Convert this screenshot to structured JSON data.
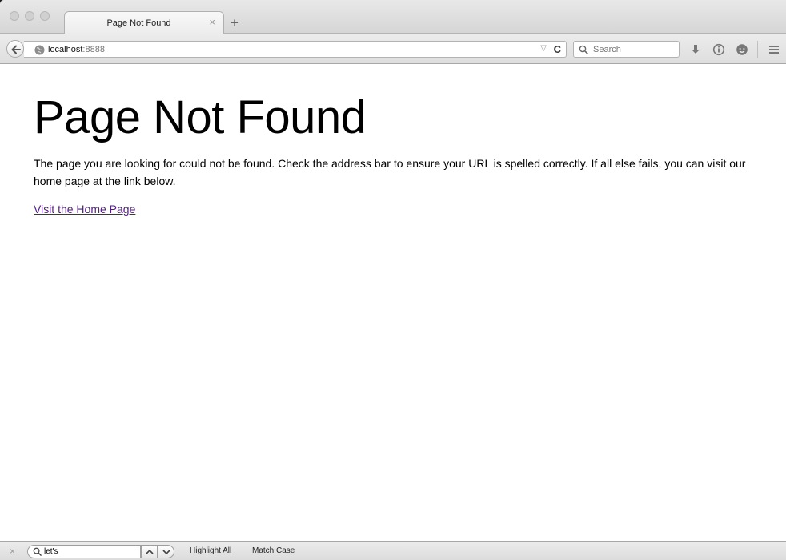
{
  "browser": {
    "tab_title": "Page Not Found",
    "tab_close": "×",
    "new_tab": "+",
    "url_host": "localhost",
    "url_port": ":8888",
    "search_placeholder": "Search",
    "dropmarker": "▽",
    "reload": "C"
  },
  "page": {
    "heading": "Page Not Found",
    "paragraph": "The page you are looking for could not be found. Check the address bar to ensure your URL is spelled correctly. If all else fails, you can visit our home page at the link below.",
    "link_text": "Visit the Home Page",
    "link_color": "#551a8b"
  },
  "findbar": {
    "close": "×",
    "query": "let's",
    "highlight_all": "Highlight All",
    "match_case": "Match Case"
  }
}
